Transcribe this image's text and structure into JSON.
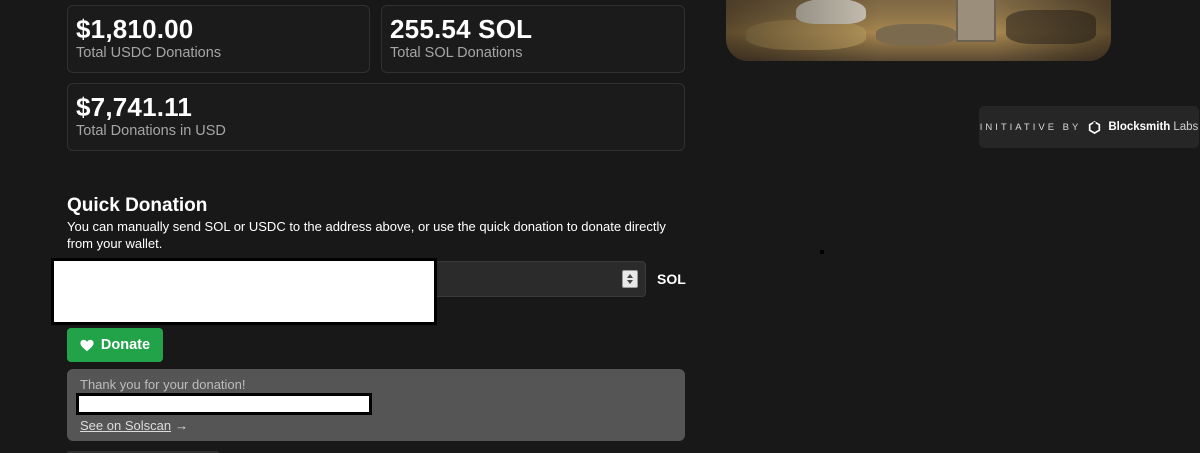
{
  "stats": {
    "usdc": {
      "value": "$1,810.00",
      "label": "Total USDC Donations"
    },
    "sol": {
      "value": "255.54 SOL",
      "label": "Total SOL Donations"
    },
    "usd": {
      "value": "$7,741.11",
      "label": "Total Donations in USD"
    }
  },
  "initiative": {
    "prefix": "INITIATIVE BY",
    "brand": "Blocksmith",
    "suffix": "Labs",
    "logo_icon": "blocksmith-hexagon-icon"
  },
  "quick_donation": {
    "title": "Quick Donation",
    "description": "You can manually send SOL or USDC to the address above, or use the quick donation to donate directly from your wallet.",
    "amount_value": "",
    "currency": "SOL",
    "donate_label": "Donate",
    "donate_icon": "heart-icon"
  },
  "confirmation": {
    "message": "Thank you for your donation!",
    "link_label": "See on Solscan",
    "link_arrow": "→"
  },
  "colors": {
    "background": "#181818",
    "card_border": "#303030",
    "donate_green": "#22a34a",
    "confirmation_bg": "#555555"
  }
}
